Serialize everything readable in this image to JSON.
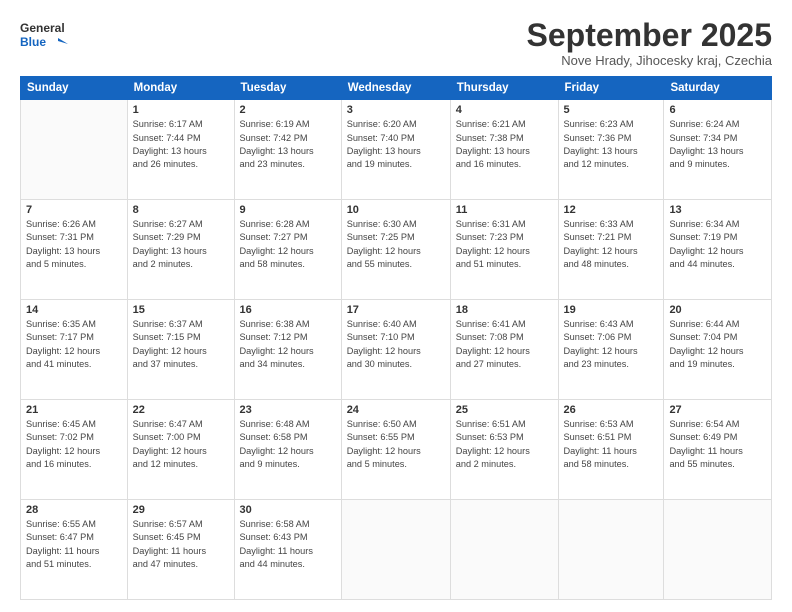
{
  "header": {
    "logo_line1": "General",
    "logo_line2": "Blue",
    "month": "September 2025",
    "location": "Nove Hrady, Jihocesky kraj, Czechia"
  },
  "days_of_week": [
    "Sunday",
    "Monday",
    "Tuesday",
    "Wednesday",
    "Thursday",
    "Friday",
    "Saturday"
  ],
  "weeks": [
    [
      null,
      {
        "day": 1,
        "lines": [
          "Sunrise: 6:17 AM",
          "Sunset: 7:44 PM",
          "Daylight: 13 hours",
          "and 26 minutes."
        ]
      },
      {
        "day": 2,
        "lines": [
          "Sunrise: 6:19 AM",
          "Sunset: 7:42 PM",
          "Daylight: 13 hours",
          "and 23 minutes."
        ]
      },
      {
        "day": 3,
        "lines": [
          "Sunrise: 6:20 AM",
          "Sunset: 7:40 PM",
          "Daylight: 13 hours",
          "and 19 minutes."
        ]
      },
      {
        "day": 4,
        "lines": [
          "Sunrise: 6:21 AM",
          "Sunset: 7:38 PM",
          "Daylight: 13 hours",
          "and 16 minutes."
        ]
      },
      {
        "day": 5,
        "lines": [
          "Sunrise: 6:23 AM",
          "Sunset: 7:36 PM",
          "Daylight: 13 hours",
          "and 12 minutes."
        ]
      },
      {
        "day": 6,
        "lines": [
          "Sunrise: 6:24 AM",
          "Sunset: 7:34 PM",
          "Daylight: 13 hours",
          "and 9 minutes."
        ]
      }
    ],
    [
      {
        "day": 7,
        "lines": [
          "Sunrise: 6:26 AM",
          "Sunset: 7:31 PM",
          "Daylight: 13 hours",
          "and 5 minutes."
        ]
      },
      {
        "day": 8,
        "lines": [
          "Sunrise: 6:27 AM",
          "Sunset: 7:29 PM",
          "Daylight: 13 hours",
          "and 2 minutes."
        ]
      },
      {
        "day": 9,
        "lines": [
          "Sunrise: 6:28 AM",
          "Sunset: 7:27 PM",
          "Daylight: 12 hours",
          "and 58 minutes."
        ]
      },
      {
        "day": 10,
        "lines": [
          "Sunrise: 6:30 AM",
          "Sunset: 7:25 PM",
          "Daylight: 12 hours",
          "and 55 minutes."
        ]
      },
      {
        "day": 11,
        "lines": [
          "Sunrise: 6:31 AM",
          "Sunset: 7:23 PM",
          "Daylight: 12 hours",
          "and 51 minutes."
        ]
      },
      {
        "day": 12,
        "lines": [
          "Sunrise: 6:33 AM",
          "Sunset: 7:21 PM",
          "Daylight: 12 hours",
          "and 48 minutes."
        ]
      },
      {
        "day": 13,
        "lines": [
          "Sunrise: 6:34 AM",
          "Sunset: 7:19 PM",
          "Daylight: 12 hours",
          "and 44 minutes."
        ]
      }
    ],
    [
      {
        "day": 14,
        "lines": [
          "Sunrise: 6:35 AM",
          "Sunset: 7:17 PM",
          "Daylight: 12 hours",
          "and 41 minutes."
        ]
      },
      {
        "day": 15,
        "lines": [
          "Sunrise: 6:37 AM",
          "Sunset: 7:15 PM",
          "Daylight: 12 hours",
          "and 37 minutes."
        ]
      },
      {
        "day": 16,
        "lines": [
          "Sunrise: 6:38 AM",
          "Sunset: 7:12 PM",
          "Daylight: 12 hours",
          "and 34 minutes."
        ]
      },
      {
        "day": 17,
        "lines": [
          "Sunrise: 6:40 AM",
          "Sunset: 7:10 PM",
          "Daylight: 12 hours",
          "and 30 minutes."
        ]
      },
      {
        "day": 18,
        "lines": [
          "Sunrise: 6:41 AM",
          "Sunset: 7:08 PM",
          "Daylight: 12 hours",
          "and 27 minutes."
        ]
      },
      {
        "day": 19,
        "lines": [
          "Sunrise: 6:43 AM",
          "Sunset: 7:06 PM",
          "Daylight: 12 hours",
          "and 23 minutes."
        ]
      },
      {
        "day": 20,
        "lines": [
          "Sunrise: 6:44 AM",
          "Sunset: 7:04 PM",
          "Daylight: 12 hours",
          "and 19 minutes."
        ]
      }
    ],
    [
      {
        "day": 21,
        "lines": [
          "Sunrise: 6:45 AM",
          "Sunset: 7:02 PM",
          "Daylight: 12 hours",
          "and 16 minutes."
        ]
      },
      {
        "day": 22,
        "lines": [
          "Sunrise: 6:47 AM",
          "Sunset: 7:00 PM",
          "Daylight: 12 hours",
          "and 12 minutes."
        ]
      },
      {
        "day": 23,
        "lines": [
          "Sunrise: 6:48 AM",
          "Sunset: 6:58 PM",
          "Daylight: 12 hours",
          "and 9 minutes."
        ]
      },
      {
        "day": 24,
        "lines": [
          "Sunrise: 6:50 AM",
          "Sunset: 6:55 PM",
          "Daylight: 12 hours",
          "and 5 minutes."
        ]
      },
      {
        "day": 25,
        "lines": [
          "Sunrise: 6:51 AM",
          "Sunset: 6:53 PM",
          "Daylight: 12 hours",
          "and 2 minutes."
        ]
      },
      {
        "day": 26,
        "lines": [
          "Sunrise: 6:53 AM",
          "Sunset: 6:51 PM",
          "Daylight: 11 hours",
          "and 58 minutes."
        ]
      },
      {
        "day": 27,
        "lines": [
          "Sunrise: 6:54 AM",
          "Sunset: 6:49 PM",
          "Daylight: 11 hours",
          "and 55 minutes."
        ]
      }
    ],
    [
      {
        "day": 28,
        "lines": [
          "Sunrise: 6:55 AM",
          "Sunset: 6:47 PM",
          "Daylight: 11 hours",
          "and 51 minutes."
        ]
      },
      {
        "day": 29,
        "lines": [
          "Sunrise: 6:57 AM",
          "Sunset: 6:45 PM",
          "Daylight: 11 hours",
          "and 47 minutes."
        ]
      },
      {
        "day": 30,
        "lines": [
          "Sunrise: 6:58 AM",
          "Sunset: 6:43 PM",
          "Daylight: 11 hours",
          "and 44 minutes."
        ]
      },
      null,
      null,
      null,
      null
    ]
  ]
}
